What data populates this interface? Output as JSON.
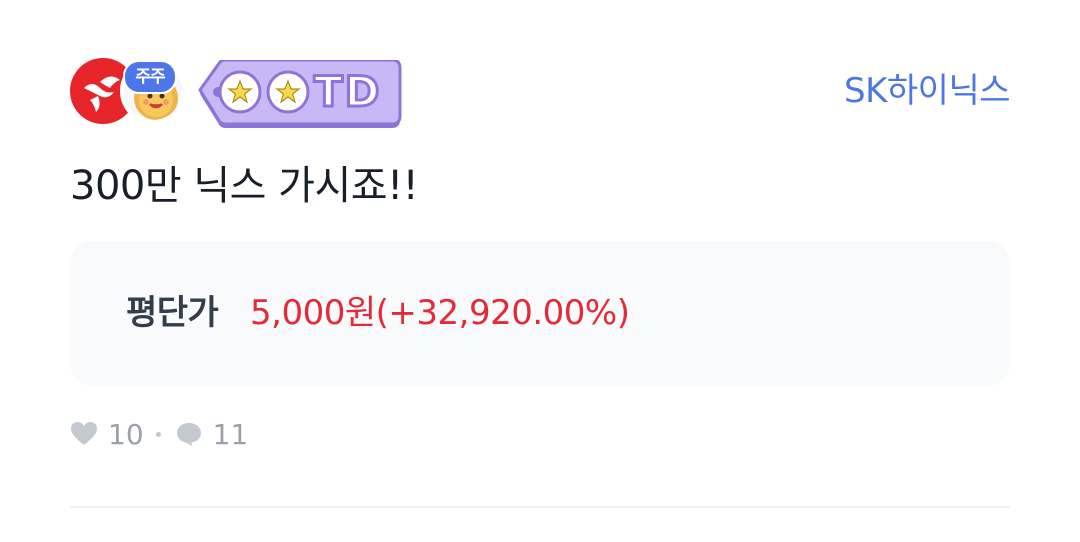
{
  "post": {
    "badge_label": "주주",
    "tag_text": "TD",
    "stock_link": "SK하이닉스",
    "text": "300만 닉스 가시죠!!"
  },
  "avg_price": {
    "label": "평단가",
    "value": "5,000원(+32,920.00%)"
  },
  "reactions": {
    "likes": "10",
    "comments": "11"
  },
  "colors": {
    "accent_blue": "#4b77e3",
    "price_red": "#e42939",
    "avatar_red": "#e8242b",
    "tag_purple": "#b7a3ee"
  },
  "icons": {
    "avatar": "sk-hynix-logo-icon",
    "badge": "cartoon-character-icon",
    "tag": "ootd-star-tag-icon",
    "like": "heart-icon",
    "comment": "comment-bubble-icon"
  }
}
